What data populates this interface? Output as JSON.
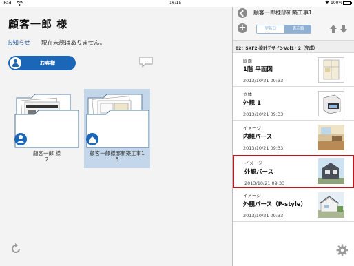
{
  "status_bar": {
    "carrier": "iPad",
    "time": "16:15",
    "battery": "100%",
    "bluetooth_icon": "bluetooth-icon",
    "wifi_icon": "wifi-icon"
  },
  "left_panel": {
    "title": "顧客一郎 様",
    "notice_label": "お知らせ",
    "notice_text": "現在未読はありません。",
    "customer_button": "お客様",
    "folders": [
      {
        "name": "顧客一郎 様",
        "count": "2",
        "selected": false
      },
      {
        "name": "顧客一郎様邸新築工事1",
        "count": "5",
        "selected": true
      }
    ]
  },
  "right_panel": {
    "title": "顧客一郎様邸新築工事1",
    "segments": [
      "更新日",
      "表示順"
    ],
    "active_segment": "表示順",
    "section_title": "02：SKF2-設計デザインVol1・2（完成）",
    "items": [
      {
        "category": "図面",
        "name": "1階 平面図",
        "date": "2013/10/21 09:33",
        "highlighted": false
      },
      {
        "category": "立体",
        "name": "外観 1",
        "date": "2013/10/21 09:33",
        "highlighted": false
      },
      {
        "category": "イメージ",
        "name": "内観パース",
        "date": "2013/10/21 09:33",
        "highlighted": false
      },
      {
        "category": "イメージ",
        "name": "外観パース",
        "date": "2013/10/21 09:33",
        "highlighted": true
      },
      {
        "category": "イメージ",
        "name": "外観パース（P-style）",
        "date": "2013/10/21 09:33",
        "highlighted": false
      }
    ]
  },
  "colors": {
    "accent_blue": "#1c66b8",
    "highlight_red": "#b01c22",
    "selection_bg": "#c4d7ea"
  }
}
